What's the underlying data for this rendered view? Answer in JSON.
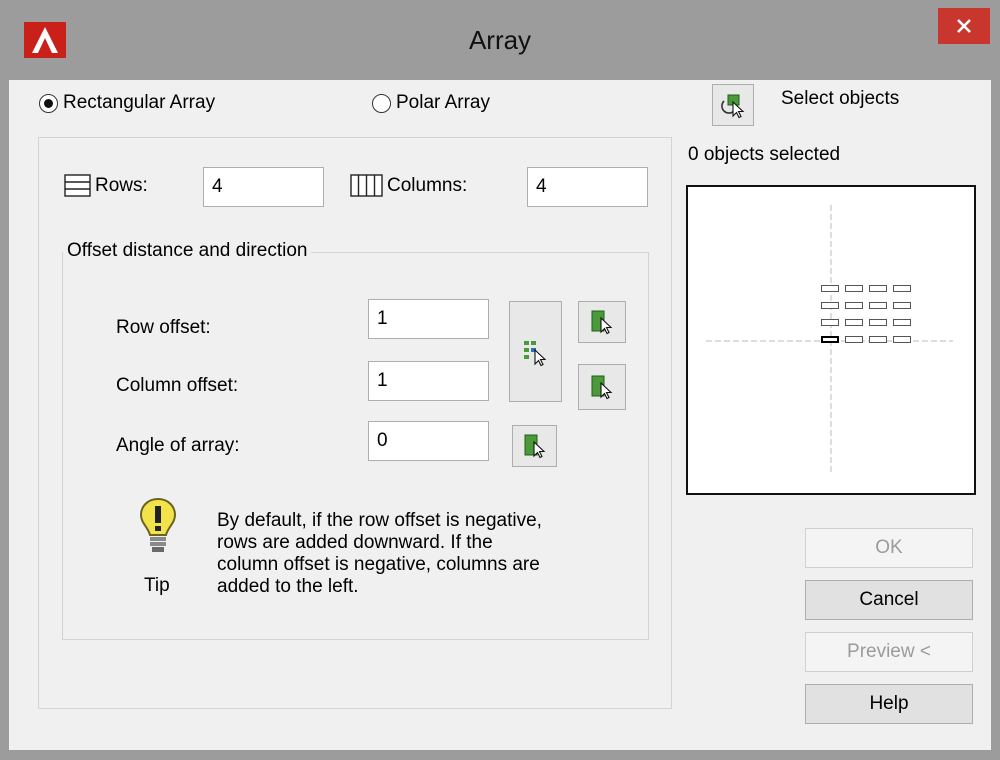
{
  "window": {
    "title": "Array"
  },
  "array_type": {
    "rectangular_label": "Rectangular Array",
    "polar_label": "Polar Array",
    "selected": "rectangular"
  },
  "selection": {
    "select_label": "Select objects",
    "status": "0 objects selected"
  },
  "grid": {
    "rows_label": "Rows:",
    "rows_value": "4",
    "columns_label": "Columns:",
    "columns_value": "4"
  },
  "offset": {
    "group_title": "Offset distance and direction",
    "row_offset_label": "Row offset:",
    "row_offset_value": "1",
    "column_offset_label": "Column offset:",
    "column_offset_value": "1",
    "angle_label": "Angle of array:",
    "angle_value": "0"
  },
  "tip": {
    "label": "Tip",
    "text_lines": [
      "By default, if the row offset is negative,",
      "rows are added downward.  If the",
      "column offset is negative, columns are",
      "added to the left."
    ]
  },
  "buttons": {
    "ok": "OK",
    "cancel": "Cancel",
    "preview": "Preview <",
    "help": "Help"
  },
  "colors": {
    "titlebar": "#9c9c9c",
    "close": "#c8362e",
    "dialog": "#f0f0f0",
    "pick_icon_green": "#4a9a3a"
  }
}
